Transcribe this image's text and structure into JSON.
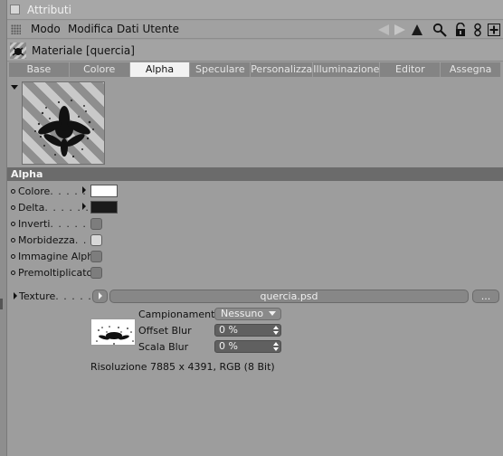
{
  "window": {
    "title": "Attributi"
  },
  "menu": {
    "items": [
      "Modo",
      "Modifica",
      "Dati Utente"
    ]
  },
  "toolbar": {
    "icons": [
      "back-forward-arrows-icon",
      "up-arrow-icon",
      "search-icon",
      "lock-icon",
      "link-icon",
      "add-panel-icon"
    ]
  },
  "material": {
    "title": "Materiale [quercia]"
  },
  "tabs": [
    {
      "label": "Base",
      "active": false
    },
    {
      "label": "Colore",
      "active": false
    },
    {
      "label": "Alpha",
      "active": true
    },
    {
      "label": "Speculare",
      "active": false
    },
    {
      "label": "Personalizza",
      "active": false
    },
    {
      "label": "Illuminazione",
      "active": false
    },
    {
      "label": "Editor",
      "active": false
    },
    {
      "label": "Assegna",
      "active": false
    }
  ],
  "section": {
    "title": "Alpha"
  },
  "properties": {
    "colore": {
      "label": "Colore",
      "dots": ". . . . . .",
      "color": "#ffffff"
    },
    "delta": {
      "label": "Delta",
      "dots": ". . . . . . .",
      "color": "#1a1a1a"
    },
    "inverti": {
      "label": "Inverti",
      "dots": ". . . . . .",
      "checked": false
    },
    "morbidezza": {
      "label": "Morbidezza",
      "dots": ". . . .",
      "checked": true
    },
    "immagine_alpha": {
      "label": "Immagine Alpha",
      "checked": false
    },
    "premoltiplicato": {
      "label": "Premoltiplicato",
      "checked": false
    }
  },
  "texture": {
    "label": "Texture",
    "dots": ". . . . . . .",
    "filename": "quercia.psd",
    "browse_label": "...",
    "campionamento": {
      "label": "Campionamento",
      "value": "Nessuno"
    },
    "offset_blur": {
      "label": "Offset Blur",
      "value": "0 %"
    },
    "scala_blur": {
      "label": "Scala Blur",
      "value": "0 %"
    },
    "resolution": "Risoluzione 7885 x 4391, RGB (8 Bit)"
  },
  "colors": {
    "panel_bg": "#9d9d9d",
    "tab_active": "#f2f2f2",
    "tab_inactive": "#848484",
    "section_header": "#6b6b6b"
  }
}
